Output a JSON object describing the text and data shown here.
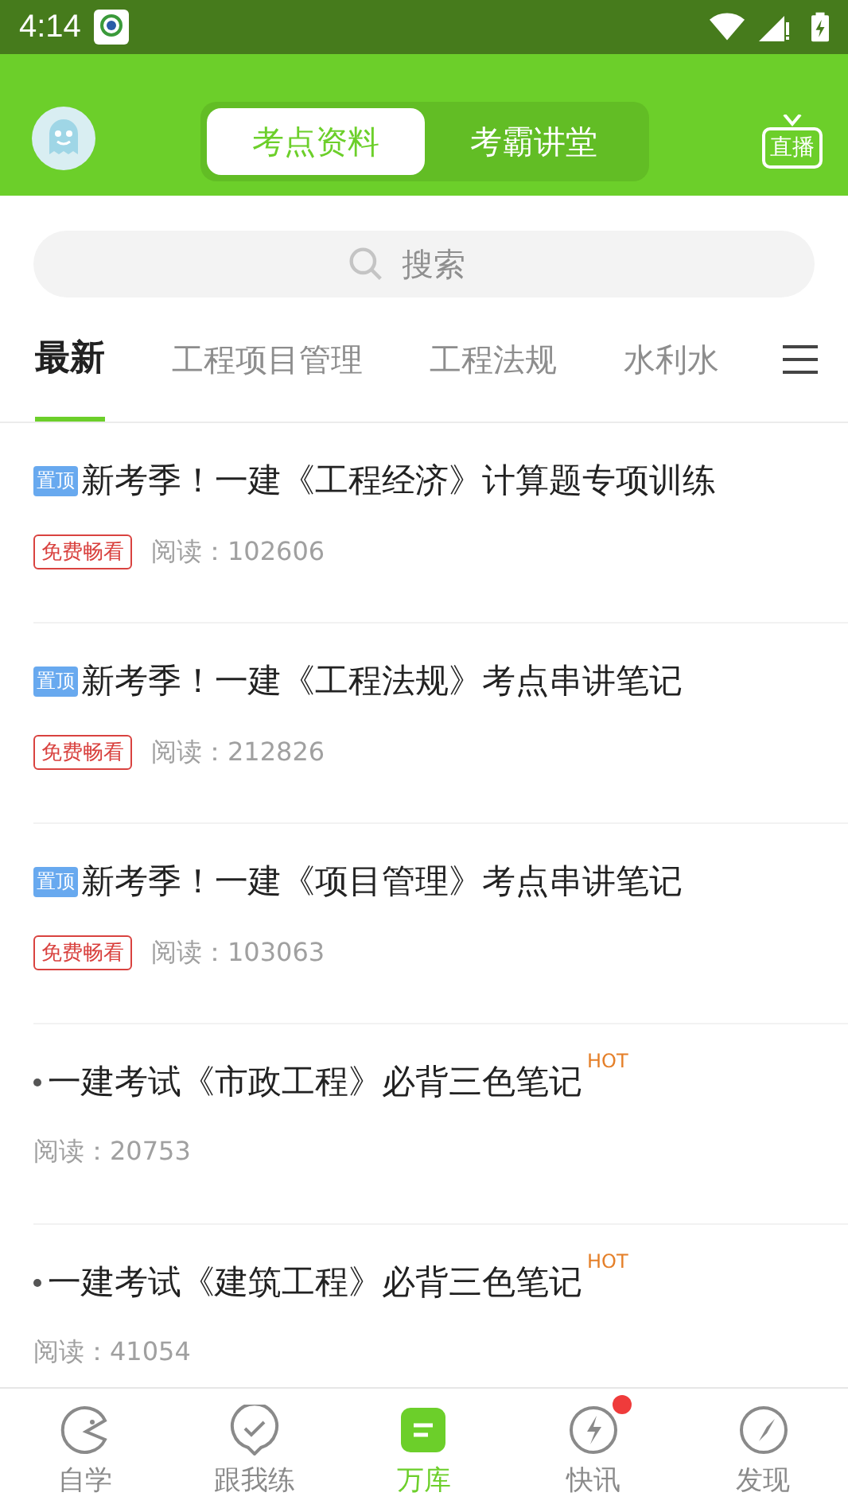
{
  "status_bar": {
    "time": "4:14"
  },
  "header": {
    "segments": [
      {
        "label": "考点资料",
        "selected": true
      },
      {
        "label": "考霸讲堂",
        "selected": false
      }
    ],
    "live_label": "直播"
  },
  "search": {
    "placeholder": "搜索"
  },
  "categories": [
    {
      "label": "最新",
      "selected": true
    },
    {
      "label": "工程项目管理",
      "selected": false
    },
    {
      "label": "工程法规",
      "selected": false
    },
    {
      "label": "水利水",
      "selected": false
    }
  ],
  "articles": [
    {
      "kind": "pinned",
      "badge": "置顶",
      "title": "新考季！一建《工程经济》计算题专项训练",
      "tag": "免费畅看",
      "reads": "阅读：102606"
    },
    {
      "kind": "pinned",
      "badge": "置顶",
      "title": "新考季！一建《工程法规》考点串讲笔记",
      "tag": "免费畅看",
      "reads": "阅读：212826"
    },
    {
      "kind": "pinned",
      "badge": "置顶",
      "title": "新考季！一建《项目管理》考点串讲笔记",
      "tag": "免费畅看",
      "reads": "阅读：103063"
    },
    {
      "kind": "hot",
      "title": "一建考试《市政工程》必背三色笔记",
      "hot": "HOT",
      "reads": "阅读：20753"
    },
    {
      "kind": "hot",
      "title": "一建考试《建筑工程》必背三色笔记",
      "hot": "HOT",
      "reads": "阅读：41054"
    }
  ],
  "bottom_nav": [
    {
      "kind": "face",
      "label": "自学",
      "selected": false,
      "dot": false
    },
    {
      "kind": "check",
      "label": "跟我练",
      "selected": false,
      "dot": false
    },
    {
      "kind": "doc",
      "label": "万库",
      "selected": true,
      "dot": false
    },
    {
      "kind": "bolt",
      "label": "快讯",
      "selected": false,
      "dot": true
    },
    {
      "kind": "compass",
      "label": "发现",
      "selected": false,
      "dot": false
    }
  ]
}
